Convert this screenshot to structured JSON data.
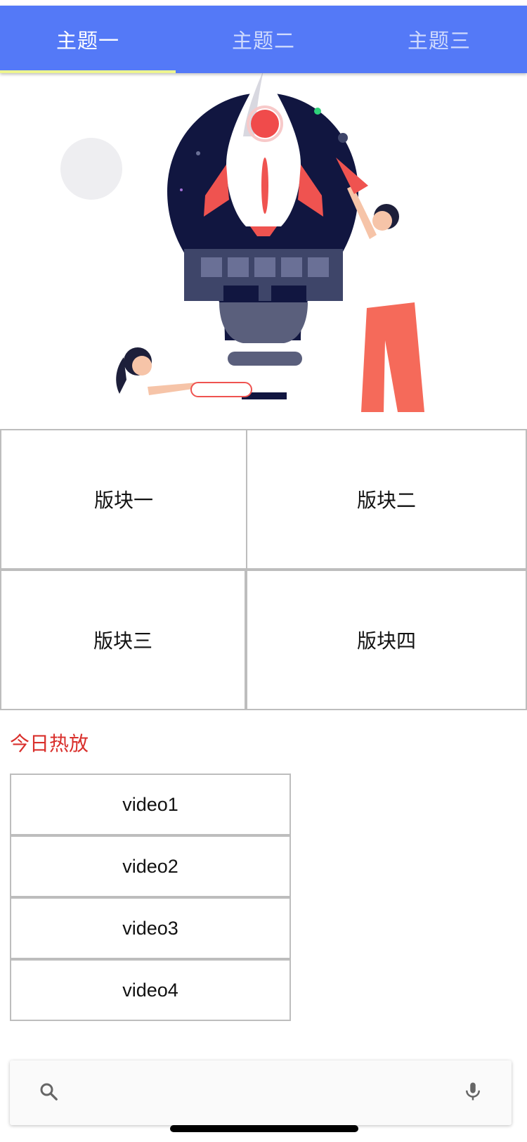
{
  "tabs": [
    {
      "label": "主题一",
      "active": true
    },
    {
      "label": "主题二",
      "active": false
    },
    {
      "label": "主题三",
      "active": false
    }
  ],
  "colors": {
    "appbar": "#5479f7",
    "tab_indicator": "#eef58f",
    "section_title": "#d9302c"
  },
  "hero": {
    "image_name": "rocket-lightbulb-illustration"
  },
  "blocks": [
    "版块一",
    "版块二",
    "版块三",
    "版块四"
  ],
  "section": {
    "title": "今日热放"
  },
  "videos": [
    "video1",
    "video2",
    "video3",
    "video4"
  ],
  "search": {
    "placeholder": "",
    "search_icon": "search-icon",
    "mic_icon": "microphone-icon"
  }
}
